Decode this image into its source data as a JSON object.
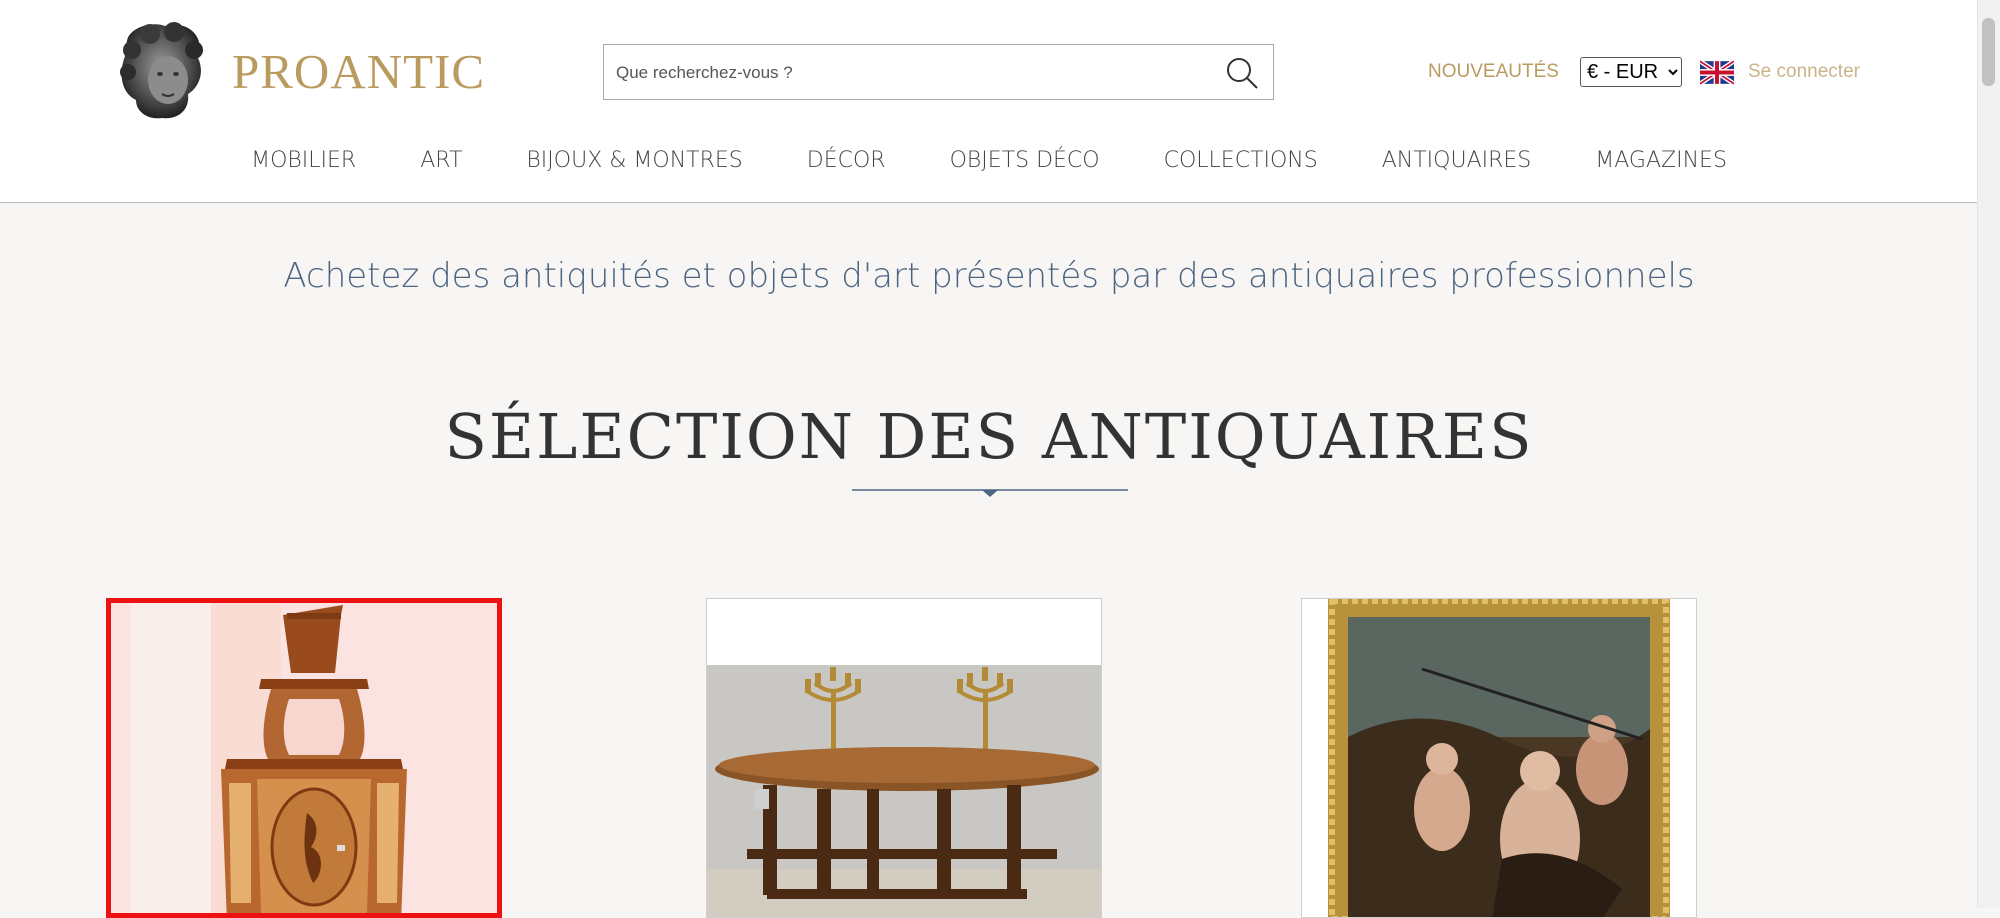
{
  "brand": {
    "name": "PROANTIC"
  },
  "search": {
    "placeholder": "Que recherchez-vous ?"
  },
  "header": {
    "new_label": "NOUVEAUTÉS",
    "currency_selected": "€ - EUR",
    "login_label": "Se connecter"
  },
  "nav": {
    "items": [
      {
        "label": "MOBILIER"
      },
      {
        "label": "ART"
      },
      {
        "label": "BIJOUX & MONTRES"
      },
      {
        "label": "DÉCOR"
      },
      {
        "label": "OBJETS DÉCO"
      },
      {
        "label": "COLLECTIONS"
      },
      {
        "label": "ANTIQUAIRES"
      },
      {
        "label": "MAGAZINES"
      }
    ]
  },
  "main": {
    "tagline": "Achetez des antiquités et objets d'art présentés par des antiquaires professionnels",
    "section_title": "SÉLECTION DES ANTIQUAIRES"
  },
  "colors": {
    "gold": "#b99b5f",
    "tagline_blue": "#4d6481",
    "highlight_red": "#ee1111",
    "background": "#f7f6f4"
  },
  "icons": {
    "logo": "cherub-head-logo",
    "search": "search-icon",
    "flag": "uk-flag-icon"
  }
}
